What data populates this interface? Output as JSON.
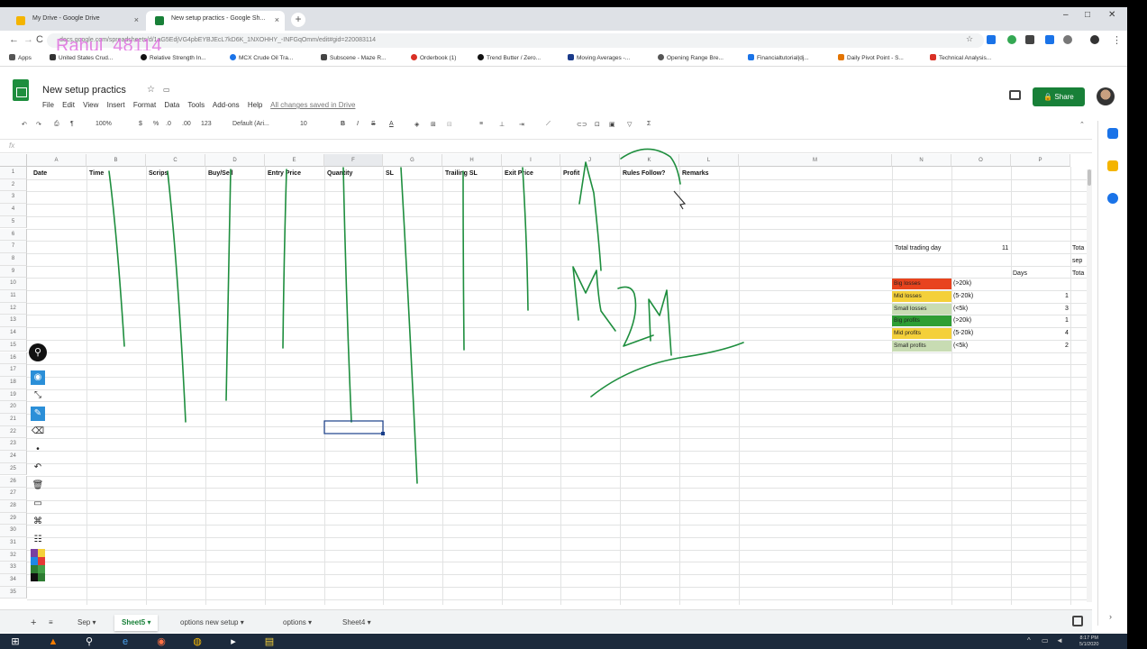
{
  "browser": {
    "tabs": [
      {
        "title": "My Drive - Google Drive",
        "active": false
      },
      {
        "title": "New setup practics - Google Sh...",
        "active": true
      }
    ],
    "url": "docs.google.com/spreadsheets/d/1aG5EdjVG4pbEYBJEcL7kD6K_1NXOHHY_-INFGqOmm/edit#gid=220083114",
    "watermark": "Rahul_48114",
    "bookmarks": [
      "Apps",
      "United States Crud...",
      "Relative Strength In...",
      "MCX Crude Oil Tra...",
      "Subscene - Maze R...",
      "Orderbook (1)",
      "Trend Butter / Zero...",
      "Moving Averages -...",
      "Opening Range Bre...",
      "Financialtutorial|dj...",
      "Daily Pivot Point - S...",
      "Technical Analysis..."
    ],
    "colors": {
      "tab_bg": "#dee1e6",
      "bookmark_icon_1": "#d93025",
      "bookmark_icon_2": "#1a73e8",
      "bookmark_icon_3": "#188038",
      "bookmark_icon_4": "#e37400"
    }
  },
  "sheets": {
    "title": "New setup practics",
    "menu": [
      "File",
      "Edit",
      "View",
      "Insert",
      "Format",
      "Data",
      "Tools",
      "Add-ons",
      "Help"
    ],
    "saved_status": "All changes saved in Drive",
    "share_label": "Share",
    "toolbar": {
      "zoom": "100%",
      "currency": "$",
      "percent": "%",
      "dec1": ".0",
      "dec2": ".00",
      "number_format": "123",
      "font": "Default (Ari...",
      "font_size": "10",
      "bold": "B",
      "italic": "I",
      "strike": "S",
      "text_color": "A"
    },
    "fx_label": "fx",
    "columns": [
      "A",
      "B",
      "C",
      "D",
      "E",
      "F",
      "G",
      "H",
      "I",
      "J",
      "K",
      "L",
      "M",
      "N",
      "O",
      "P"
    ],
    "selected_column": "F",
    "rows": [
      "1",
      "2",
      "3",
      "4",
      "5",
      "6",
      "7",
      "8",
      "9",
      "10",
      "11",
      "12",
      "13",
      "14",
      "15",
      "16",
      "17",
      "18",
      "19",
      "20",
      "21",
      "22",
      "23",
      "24",
      "25",
      "26",
      "27",
      "28",
      "29",
      "30",
      "31",
      "32",
      "33",
      "34",
      "35"
    ],
    "headers": [
      "Date",
      "Time",
      "Scrips",
      "Buy/Sell",
      "Entry Price",
      "Quantity",
      "SL",
      "Trailing SL",
      "Exit Price",
      "Profit",
      "Rules Follow?",
      "Remarks"
    ],
    "summary": {
      "total_days_label": "Total trading day",
      "total_days_value": "11",
      "days_label": "Days",
      "p_col": [
        "Tota",
        "sep",
        "Tota"
      ],
      "legend": [
        {
          "label": "Big losses",
          "range": "(>20k)",
          "count": "",
          "color": "#e8431e"
        },
        {
          "label": "Mid losses",
          "range": "(5-20k)",
          "count": "1",
          "color": "#f4d03a"
        },
        {
          "label": "Small losses",
          "range": "(<5k)",
          "count": "3",
          "color": "#c8dcb3"
        },
        {
          "label": "Big profits",
          "range": "(>20k)",
          "count": "1",
          "color": "#2f9e34"
        },
        {
          "label": "Mid profits",
          "range": "(5-20k)",
          "count": "4",
          "color": "#f4d03a"
        },
        {
          "label": "Small profits",
          "range": "(<5k)",
          "count": "2",
          "color": "#c8dcb3"
        }
      ]
    },
    "sheet_tabs": [
      {
        "name": "Sep",
        "active": false
      },
      {
        "name": "Sheet5",
        "active": true
      },
      {
        "name": "options new setup",
        "active": false
      },
      {
        "name": "options",
        "active": false
      },
      {
        "name": "Sheet4",
        "active": false
      }
    ],
    "colors": {
      "accent_green": "#188038",
      "ink": "#1e8e3e"
    }
  },
  "taskbar": {
    "time": "8:17 PM",
    "date": "5/1/2020"
  }
}
